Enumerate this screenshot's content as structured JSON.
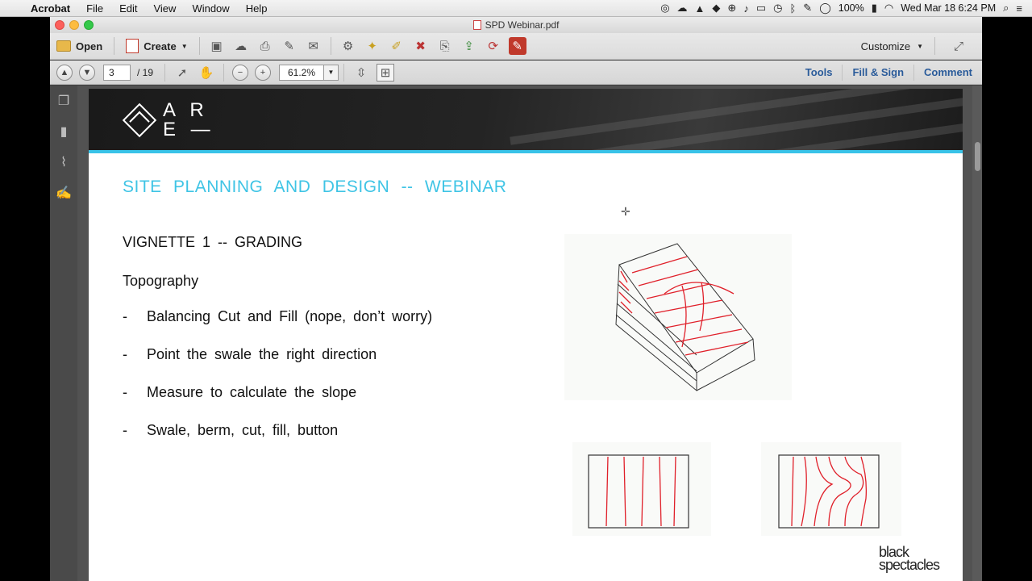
{
  "menubar": {
    "app_name": "Acrobat",
    "items": [
      "File",
      "Edit",
      "View",
      "Window",
      "Help"
    ],
    "battery": "100%",
    "clock": "Wed Mar 18  6:24 PM"
  },
  "window": {
    "title": "SPD Webinar.pdf"
  },
  "toolbar": {
    "open_label": "Open",
    "create_label": "Create",
    "customize_label": "Customize"
  },
  "nav": {
    "current_page": "3",
    "total_pages": "/ 19",
    "zoom": "61.2%"
  },
  "panels": {
    "tools": "Tools",
    "fill_sign": "Fill & Sign",
    "comment": "Comment"
  },
  "slide": {
    "logo_line1": "A R",
    "logo_line2": "E —",
    "title": "SITE  PLANNING  AND  DESIGN    --    WEBINAR",
    "vignette": "VIGNETTE  1  --  GRADING",
    "topic": "Topography",
    "bullets": [
      "Balancing  Cut  and  Fill  (nope,  don’t  worry)",
      "Point  the  swale  the  right  direction",
      "Measure  to  calculate  the  slope",
      "Swale,  berm,  cut,  fill,  button"
    ],
    "bullet_marker": "-",
    "brand_line1": "black",
    "brand_line2": "spectacles"
  },
  "colors": {
    "accent_cyan": "#3fc4e5",
    "sketch_red": "#e0202a",
    "sketch_ink": "#333333"
  }
}
